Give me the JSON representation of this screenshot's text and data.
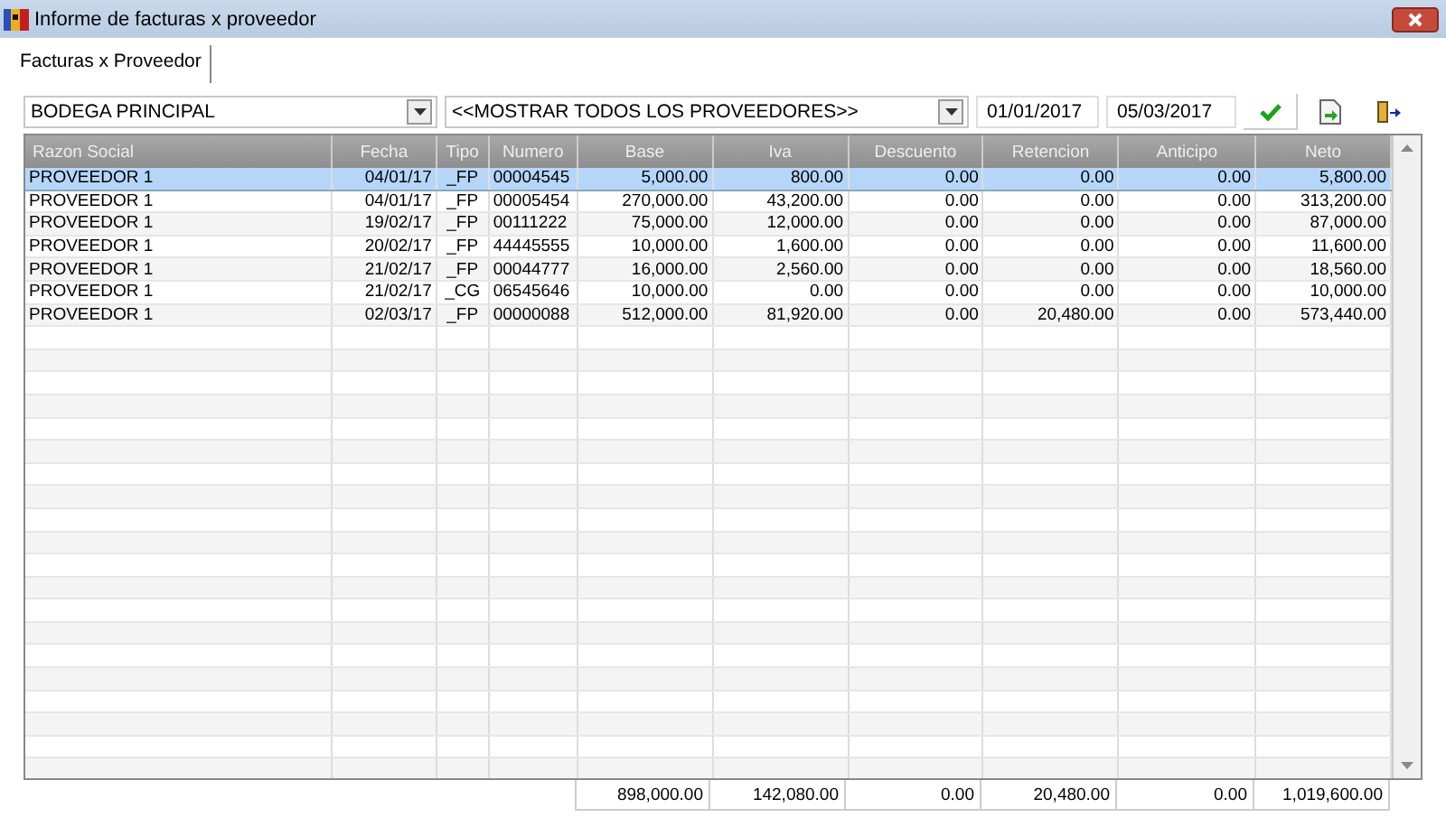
{
  "window": {
    "title": "Informe de facturas x proveedor"
  },
  "tabs": [
    {
      "label": "Facturas x Proveedor",
      "selected": true
    }
  ],
  "filters": {
    "warehouse": "BODEGA PRINCIPAL",
    "supplier": "<<MOSTRAR TODOS LOS PROVEEDORES>>",
    "date_from": "01/01/2017",
    "date_to": "05/03/2017"
  },
  "table": {
    "columns": [
      "Razon Social",
      "Fecha",
      "Tipo",
      "Numero",
      "Base",
      "Iva",
      "Descuento",
      "Retencion",
      "Anticipo",
      "Neto"
    ],
    "rows": [
      {
        "selected": true,
        "cells": [
          "PROVEEDOR 1",
          "04/01/17",
          "_FP",
          "00004545",
          "5,000.00",
          "800.00",
          "0.00",
          "0.00",
          "0.00",
          "5,800.00"
        ]
      },
      {
        "selected": false,
        "cells": [
          "PROVEEDOR 1",
          "04/01/17",
          "_FP",
          "00005454",
          "270,000.00",
          "43,200.00",
          "0.00",
          "0.00",
          "0.00",
          "313,200.00"
        ]
      },
      {
        "selected": false,
        "cells": [
          "PROVEEDOR 1",
          "19/02/17",
          "_FP",
          "00111222",
          "75,000.00",
          "12,000.00",
          "0.00",
          "0.00",
          "0.00",
          "87,000.00"
        ]
      },
      {
        "selected": false,
        "cells": [
          "PROVEEDOR 1",
          "20/02/17",
          "_FP",
          "44445555",
          "10,000.00",
          "1,600.00",
          "0.00",
          "0.00",
          "0.00",
          "11,600.00"
        ]
      },
      {
        "selected": false,
        "cells": [
          "PROVEEDOR 1",
          "21/02/17",
          "_FP",
          "00044777",
          "16,000.00",
          "2,560.00",
          "0.00",
          "0.00",
          "0.00",
          "18,560.00"
        ]
      },
      {
        "selected": false,
        "cells": [
          "PROVEEDOR 1",
          "21/02/17",
          "_CG",
          "06545646",
          "10,000.00",
          "0.00",
          "0.00",
          "0.00",
          "0.00",
          "10,000.00"
        ]
      },
      {
        "selected": false,
        "cells": [
          "PROVEEDOR 1",
          "02/03/17",
          "_FP",
          "00000088",
          "512,000.00",
          "81,920.00",
          "0.00",
          "20,480.00",
          "0.00",
          "573,440.00"
        ]
      }
    ],
    "totals": [
      "898,000.00",
      "142,080.00",
      "0.00",
      "20,480.00",
      "0.00",
      "1,019,600.00"
    ]
  }
}
